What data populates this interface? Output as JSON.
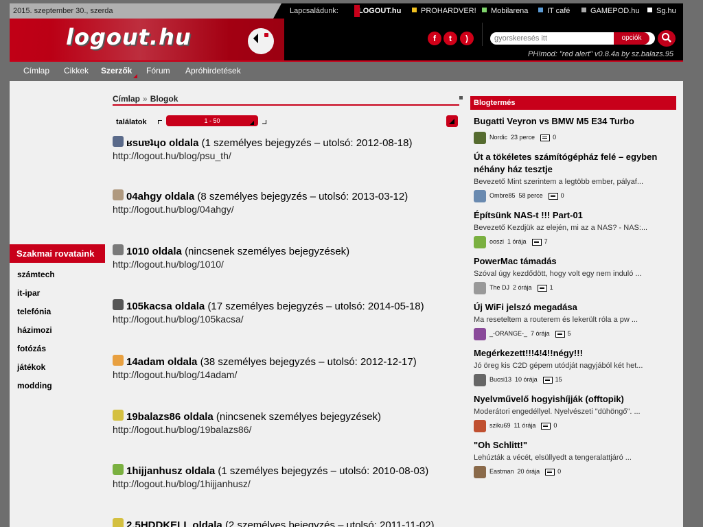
{
  "topbar": {
    "date": "2015. szeptember 30., szerda",
    "family_label": "Lapcsaládunk:",
    "family": [
      {
        "label": "LOGOUT.hu",
        "color": "#c8001a"
      },
      {
        "label": "PROHARDVER!",
        "color": "#f0c020"
      },
      {
        "label": "Mobilarena",
        "color": "#7ed36b"
      },
      {
        "label": "IT café",
        "color": "#5b9bd5"
      },
      {
        "label": "GAMEPOD.hu",
        "color": "#aaaaaa"
      },
      {
        "label": "Sg.hu",
        "color": "#ffffff"
      }
    ]
  },
  "header": {
    "logo": "logout.hu",
    "social": [
      "facebook-icon",
      "twitter-icon",
      "rss-icon"
    ],
    "search_placeholder": "gyorskeresés itt",
    "search_options": "opciók",
    "mod_line": "PH!mod: \"red alert\" v0.8.4a by sz.balazs.95"
  },
  "nav": {
    "items": [
      "Címlap",
      "Cikkek",
      "Szerzők",
      "Fórum",
      "Apróhirdetések"
    ],
    "active": "Szerzők"
  },
  "leftnav": {
    "title": "Szakmai rovataink",
    "items": [
      "számtech",
      "it-ipar",
      "telefónia",
      "házimozi",
      "fotózás",
      "játékok",
      "modding"
    ]
  },
  "breadcrumb": {
    "home": "Címlap",
    "current": "Blogok"
  },
  "pager": {
    "hits_label": "találatok",
    "range": "1 - 50"
  },
  "blogs": [
    {
      "name": "ʁsuɐʇɥo oldala",
      "detail": "(1 személyes bejegyzés – utolsó: 2012-08-18)",
      "url": "http://logout.hu/blog/psu_th/",
      "avatar_color": "#5a6a8a"
    },
    {
      "name": "04ahgy oldala",
      "detail": "(8 személyes bejegyzés – utolsó: 2013-03-12)",
      "url": "http://logout.hu/blog/04ahgy/",
      "avatar_color": "#b09a80"
    },
    {
      "name": "1010 oldala",
      "detail": "(nincsenek személyes bejegyzések)",
      "url": "http://logout.hu/blog/1010/",
      "avatar_color": "#7a7a7a"
    },
    {
      "name": "105kacsa oldala",
      "detail": "(17 személyes bejegyzés – utolsó: 2014-05-18)",
      "url": "http://logout.hu/blog/105kacsa/",
      "avatar_color": "#555555"
    },
    {
      "name": "14adam oldala",
      "detail": "(38 személyes bejegyzés – utolsó: 2012-12-17)",
      "url": "http://logout.hu/blog/14adam/",
      "avatar_color": "#e8a040"
    },
    {
      "name": "19balazs86 oldala",
      "detail": "(nincsenek személyes bejegyzések)",
      "url": "http://logout.hu/blog/19balazs86/",
      "avatar_color": "#d4c040"
    },
    {
      "name": "1hijjanhusz oldala",
      "detail": "(1 személyes bejegyzés – utolsó: 2010-08-03)",
      "url": "http://logout.hu/blog/1hijjanhusz/",
      "avatar_color": "#7ab040"
    },
    {
      "name": "2.5HDDKELL oldala",
      "detail": "(2 személyes bejegyzés – utolsó: 2011-11-02)",
      "url": "",
      "avatar_color": "#d4c040"
    }
  ],
  "blogtermes": {
    "title": "Blogtermés",
    "posts": [
      {
        "title": "Bugatti Veyron vs BMW M5 E34 Turbo",
        "excerpt": "",
        "author": "Nordic",
        "time": "23 perce",
        "comments": "0",
        "avatar_color": "#556b2f"
      },
      {
        "title": "Út a tökéletes számítógépház felé – egyben néhány ház tesztje",
        "excerpt": "Bevezető Mint szerintem a legtöbb ember, pályaf...",
        "author": "Ombre85",
        "time": "58 perce",
        "comments": "0",
        "avatar_color": "#6a8ab0"
      },
      {
        "title": "Építsünk NAS-t !!! Part-01",
        "excerpt": "Bevezető Kezdjük az elején, mi az a NAS? - NAS:...",
        "author": "ooszi",
        "time": "1 órája",
        "comments": "7",
        "avatar_color": "#7ab040"
      },
      {
        "title": "PowerMac támadás",
        "excerpt": "Szóval úgy kezdődött, hogy volt egy nem induló ...",
        "author": "The DJ",
        "time": "2 órája",
        "comments": "1",
        "avatar_color": "#999999"
      },
      {
        "title": "Új WiFi jelszó megadása",
        "excerpt": "Ma reseteltem a routerem és lekerült róla a pw ...",
        "author": "_-ORANGE-_",
        "time": "7 órája",
        "comments": "5",
        "avatar_color": "#8a4a9a"
      },
      {
        "title": "Megérkezett!!!4!4!!négy!!!",
        "excerpt": "Jó öreg kis C2D gépem utódját nagyjából két het...",
        "author": "Bucsi13",
        "time": "10 órája",
        "comments": "15",
        "avatar_color": "#666666"
      },
      {
        "title": "Nyelvművelő hogyishíjják (offtopik)",
        "excerpt": "Moderátori engedéllyel. Nyelvészeti \"dühöngő\". ...",
        "author": "sziku69",
        "time": "11 órája",
        "comments": "0",
        "avatar_color": "#c05030"
      },
      {
        "title": "\"Oh Schlitt!\"",
        "excerpt": "Lehúzták a vécét, elsüllyedt a tengeralattjáró ...",
        "author": "Eastman",
        "time": "20 órája",
        "comments": "0",
        "avatar_color": "#8a6a4a"
      }
    ]
  }
}
